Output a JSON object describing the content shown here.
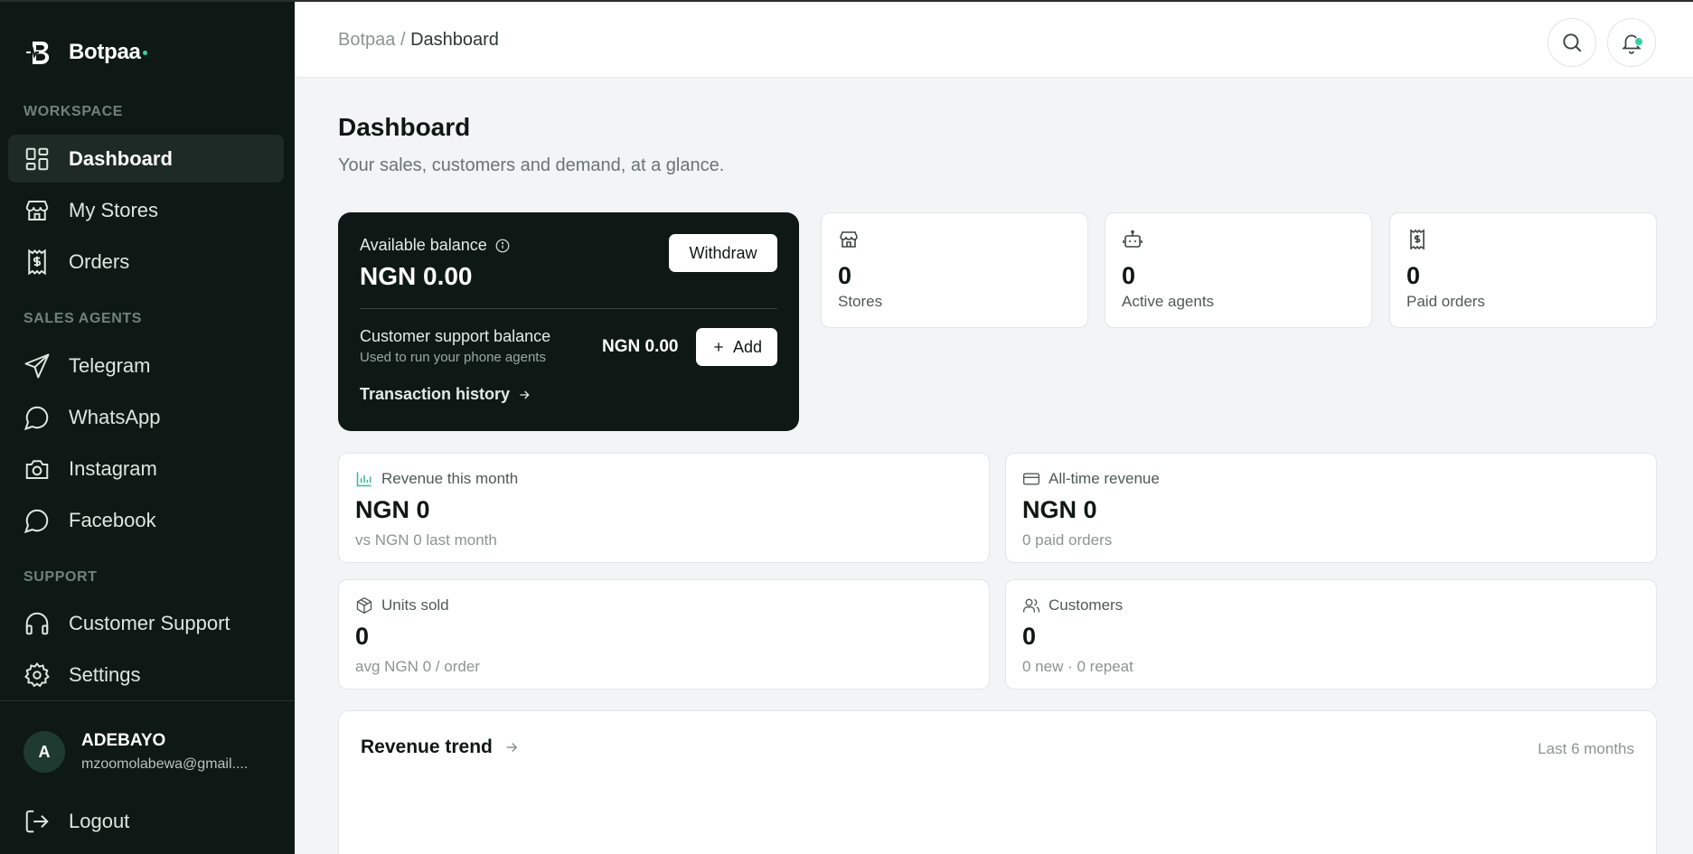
{
  "brand": {
    "name": "Botpaa",
    "accent": "#2fd5a0"
  },
  "sidebar": {
    "workspace_label": "WORKSPACE",
    "sales_agents_label": "SALES AGENTS",
    "support_label": "SUPPORT",
    "items": [
      {
        "label": "Dashboard",
        "icon": "grid-icon",
        "active": true
      },
      {
        "label": "My Stores",
        "icon": "store-icon"
      },
      {
        "label": "Orders",
        "icon": "receipt-icon"
      },
      {
        "label": "Telegram",
        "icon": "send-icon"
      },
      {
        "label": "WhatsApp",
        "icon": "chat-bubble-icon"
      },
      {
        "label": "Instagram",
        "icon": "camera-icon"
      },
      {
        "label": "Facebook",
        "icon": "chat-bubble-icon"
      },
      {
        "label": "Customer Support",
        "icon": "headphones-icon"
      },
      {
        "label": "Settings",
        "icon": "gear-icon"
      }
    ],
    "user": {
      "initial": "A",
      "name": "ADEBAYO",
      "email": "mzoomolabewa@gmail...."
    },
    "logout_label": "Logout"
  },
  "topbar": {
    "breadcrumb_root": "Botpaa",
    "breadcrumb_sep": "/",
    "breadcrumb_current": "Dashboard"
  },
  "main": {
    "title": "Dashboard",
    "subtitle": "Your sales, customers and demand, at a glance.",
    "balance": {
      "label": "Available balance",
      "amount": "NGN 0.00",
      "withdraw_label": "Withdraw",
      "support_label": "Customer support balance",
      "support_sub": "Used to run your phone agents",
      "support_amount": "NGN 0.00",
      "add_label": "Add",
      "history_label": "Transaction history"
    },
    "stats": [
      {
        "value": "0",
        "label": "Stores",
        "icon": "store-icon"
      },
      {
        "value": "0",
        "label": "Active agents",
        "icon": "bot-icon"
      },
      {
        "value": "0",
        "label": "Paid orders",
        "icon": "receipt-icon"
      }
    ],
    "metrics": [
      {
        "title": "Revenue this month",
        "value": "NGN 0",
        "sub": "vs NGN 0 last month",
        "icon": "bar-chart-icon"
      },
      {
        "title": "All-time revenue",
        "value": "NGN 0",
        "sub": "0 paid orders",
        "icon": "credit-card-icon"
      },
      {
        "title": "Units sold",
        "value": "0",
        "sub": "avg NGN 0 / order",
        "icon": "box-icon"
      },
      {
        "title": "Customers",
        "value": "0",
        "sub": "0 new · 0 repeat",
        "icon": "users-icon"
      }
    ],
    "trend": {
      "title": "Revenue trend",
      "range": "Last 6 months"
    }
  }
}
